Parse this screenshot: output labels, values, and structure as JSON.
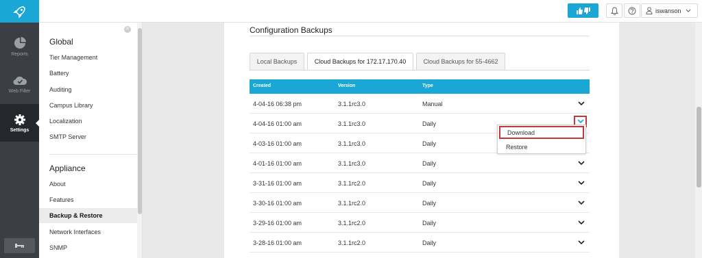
{
  "rail": {
    "items": [
      {
        "label": "Reports",
        "icon": "pie-chart-icon"
      },
      {
        "label": "Web Filter",
        "icon": "cloud-check-icon"
      },
      {
        "label": "Settings",
        "icon": "gear-icon"
      }
    ],
    "accent": "#1aa7d6"
  },
  "topbar": {
    "username": "iswanson"
  },
  "settings_nav": {
    "global_title": "Global",
    "global_items": [
      "Tier Management",
      "Battery",
      "Auditing",
      "Campus Library",
      "Localization",
      "SMTP Server"
    ],
    "appliance_title": "Appliance",
    "appliance_items": [
      "About",
      "Features",
      "Backup & Restore",
      "Network Interfaces",
      "SNMP"
    ]
  },
  "main": {
    "title": "Configuration Backups",
    "tabs": [
      "Local Backups",
      "Cloud Backups for 172.17.170.40",
      "Cloud Backups for 55-4662"
    ],
    "active_tab": 1,
    "columns": [
      "Created",
      "Version",
      "Type"
    ],
    "rows": [
      {
        "created": "4-04-16 06:38 pm",
        "version": "3.1.1rc3.0",
        "type": "Manual"
      },
      {
        "created": "4-04-16 01:00 am",
        "version": "3.1.1rc3.0",
        "type": "Daily"
      },
      {
        "created": "4-03-16 01:00 am",
        "version": "3.1.1rc3.0",
        "type": "Daily"
      },
      {
        "created": "4-01-16 01:00 am",
        "version": "3.1.1rc3.0",
        "type": "Daily"
      },
      {
        "created": "3-31-16 01:00 am",
        "version": "3.1.1rc2.0",
        "type": "Daily"
      },
      {
        "created": "3-30-16 01:00 am",
        "version": "3.1.1rc2.0",
        "type": "Daily"
      },
      {
        "created": "3-29-16 01:00 am",
        "version": "3.1.1rc2.0",
        "type": "Daily"
      },
      {
        "created": "3-28-16 01:00 am",
        "version": "3.1.1rc2.0",
        "type": "Daily"
      }
    ],
    "dropdown": [
      "Download",
      "Restore"
    ]
  },
  "colors": {
    "header_bg": "#1aa7d6",
    "highlight": "#c0383c",
    "rail_bg": "#3b3f44"
  }
}
